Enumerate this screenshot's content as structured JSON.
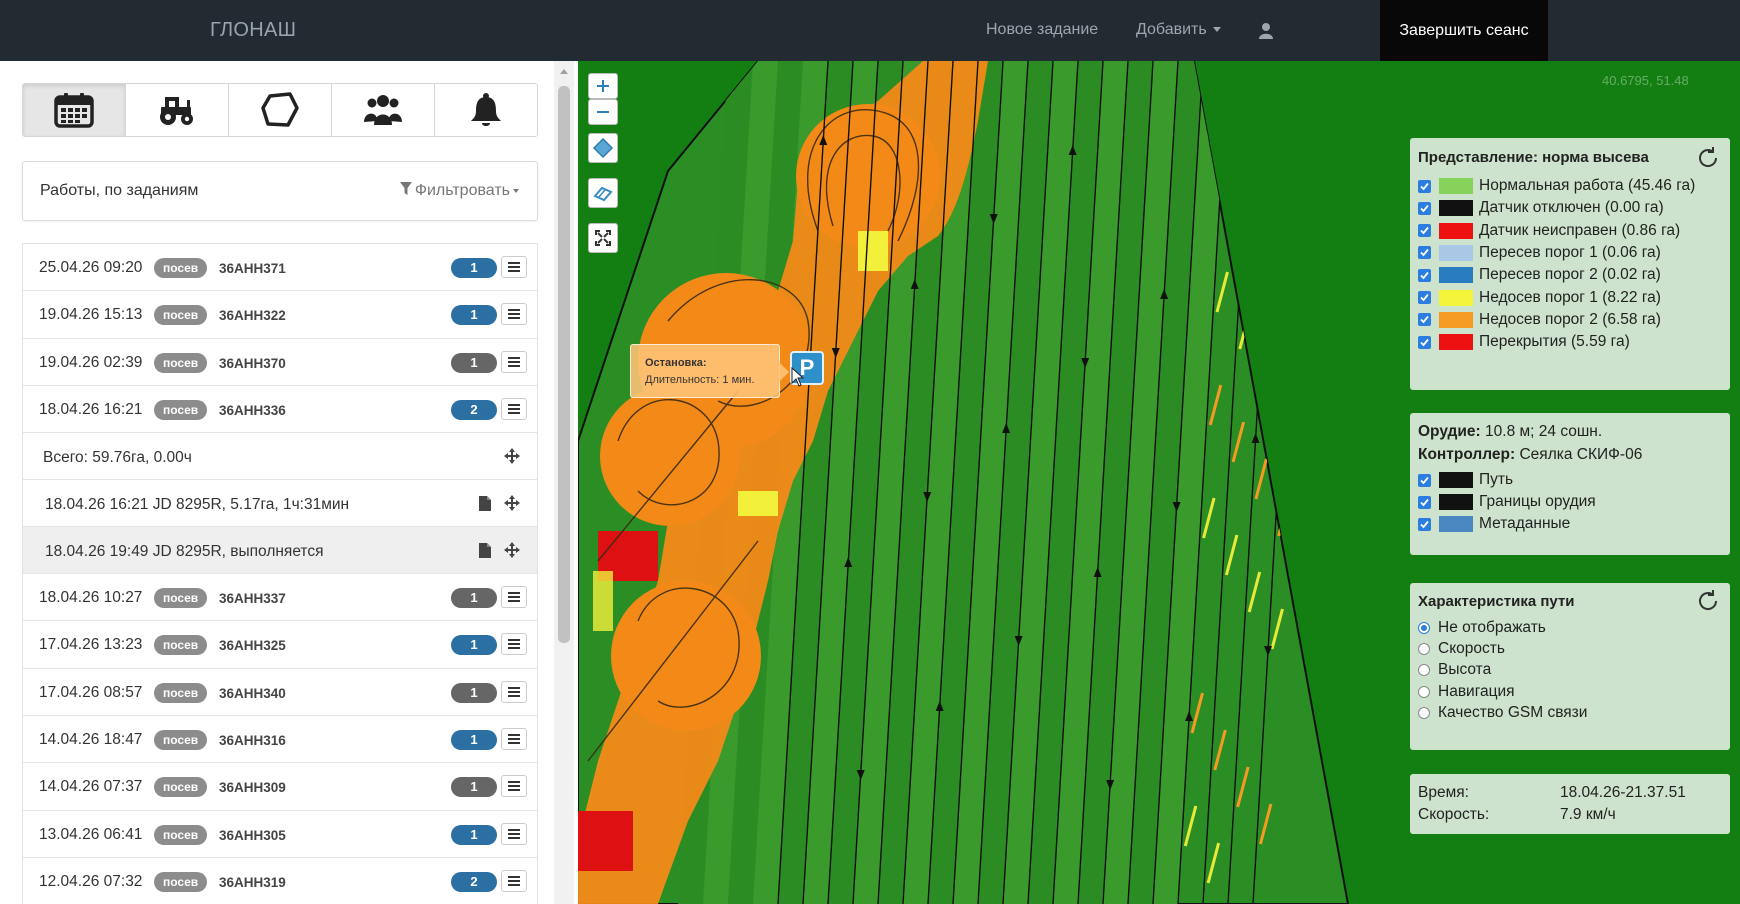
{
  "navbar": {
    "brand": "ГЛОНАШ",
    "new_task": "Новое задание",
    "add": "Добавить",
    "logout": "Завершить сеанс"
  },
  "tabs": [
    {
      "name": "calendar-icon",
      "active": true
    },
    {
      "name": "tractor-icon",
      "active": false
    },
    {
      "name": "polygon-icon",
      "active": false
    },
    {
      "name": "users-icon",
      "active": false
    },
    {
      "name": "bell-icon",
      "active": false
    }
  ],
  "filter": {
    "title": "Работы, по заданиям",
    "button": "Фильтровать"
  },
  "works": [
    {
      "date": "25.04.26 09:20",
      "type": "посев",
      "code": "36АНН371",
      "count": "1",
      "count_color": "#2b6fa3"
    },
    {
      "date": "19.04.26 15:13",
      "type": "посев",
      "code": "36АНН322",
      "count": "1",
      "count_color": "#2b6fa3"
    },
    {
      "date": "19.04.26 02:39",
      "type": "посев",
      "code": "36АНН370",
      "count": "1",
      "count_color": "#666666"
    },
    {
      "date": "18.04.26 16:21",
      "type": "посев",
      "code": "36АНН336",
      "count": "2",
      "count_color": "#2b6fa3"
    }
  ],
  "expanded": {
    "total": "Всего: 59.76га, 0.00ч",
    "items": [
      {
        "text": "18.04.26 16:21 JD 8295R, 5.17га, 1ч:31мин"
      },
      {
        "text": "18.04.26 19:49 JD 8295R, выполняется"
      }
    ]
  },
  "works_after": [
    {
      "date": "18.04.26 10:27",
      "type": "посев",
      "code": "36АНН337",
      "count": "1",
      "count_color": "#666666"
    },
    {
      "date": "17.04.26 13:23",
      "type": "посев",
      "code": "36АНН325",
      "count": "1",
      "count_color": "#2b6fa3"
    },
    {
      "date": "17.04.26 08:57",
      "type": "посев",
      "code": "36АНН340",
      "count": "1",
      "count_color": "#666666"
    },
    {
      "date": "14.04.26 18:47",
      "type": "посев",
      "code": "36АНН316",
      "count": "1",
      "count_color": "#2b6fa3"
    },
    {
      "date": "14.04.26 07:37",
      "type": "посев",
      "code": "36АНН309",
      "count": "1",
      "count_color": "#666666"
    },
    {
      "date": "13.04.26 06:41",
      "type": "посев",
      "code": "36АНН305",
      "count": "1",
      "count_color": "#2b6fa3"
    },
    {
      "date": "12.04.26 07:32",
      "type": "посев",
      "code": "36АНН319",
      "count": "2",
      "count_color": "#2b6fa3"
    }
  ],
  "map": {
    "coords": "40.6795, 51.48",
    "tooltip_title": "Остановка:",
    "tooltip_text": "Длительность: 1 мин.",
    "parking_label": "P"
  },
  "legend": {
    "title": "Представление: норма высева",
    "items": [
      {
        "label": "Нормальная работа (45.46 га)",
        "color": "#86d25a"
      },
      {
        "label": "Датчик отключен (0.00 га)",
        "color": "#111111"
      },
      {
        "label": "Датчик неисправен (0.86 га)",
        "color": "#ee1111"
      },
      {
        "label": "Пересев порог 1 (0.06 га)",
        "color": "#a8c8e6"
      },
      {
        "label": "Пересев порог 2 (0.02 га)",
        "color": "#2a7cc0"
      },
      {
        "label": "Недосев порог 1 (8.22 га)",
        "color": "#f3f33a"
      },
      {
        "label": "Недосев порог 2 (6.58 га)",
        "color": "#f59a22"
      },
      {
        "label": "Перекрытия (5.59 га)",
        "color": "#ee1111"
      }
    ]
  },
  "tool": {
    "tool_label": "Орудие:",
    "tool_value": "10.8 м; 24 сошн.",
    "controller_label": "Контроллер:",
    "controller_value": "Сеялка СКИФ-06",
    "items": [
      {
        "label": "Путь",
        "color": "#111111"
      },
      {
        "label": "Границы орудия",
        "color": "#111111"
      },
      {
        "label": "Метаданные",
        "color": "#4a86c0"
      }
    ]
  },
  "path": {
    "title": "Характеристика пути",
    "options": [
      {
        "label": "Не отображать",
        "selected": true
      },
      {
        "label": "Скорость",
        "selected": false
      },
      {
        "label": "Высота",
        "selected": false
      },
      {
        "label": "Навигация",
        "selected": false
      },
      {
        "label": "Качество GSM связи",
        "selected": false
      }
    ]
  },
  "info": {
    "time_label": "Время:",
    "time_value": "18.04.26-21.37.51",
    "speed_label": "Скорость:",
    "speed_value": "7.9 км/ч"
  }
}
